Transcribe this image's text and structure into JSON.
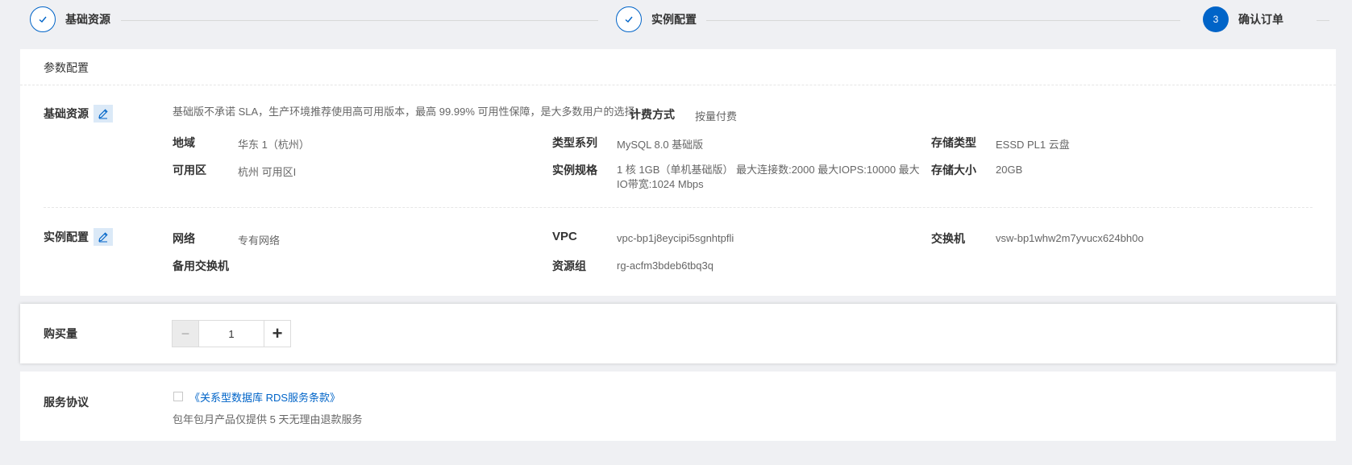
{
  "steps": [
    {
      "label": "基础资源",
      "status": "done",
      "icon": "check-icon"
    },
    {
      "label": "实例配置",
      "status": "done",
      "icon": "check-icon"
    },
    {
      "label": "确认订单",
      "status": "active",
      "number": "3"
    }
  ],
  "config_panel": {
    "title": "参数配置",
    "basic": {
      "label": "基础资源",
      "note": "基础版不承诺 SLA，生产环境推荐使用高可用版本，最高 99.99% 可用性保障，是大多数用户的选择!",
      "billing_key": "计费方式",
      "billing_value": "按量付费",
      "region_key": "地域",
      "region_value": "华东 1（杭州）",
      "series_key": "类型系列",
      "series_value": "MySQL 8.0 基础版",
      "storage_type_key": "存储类型",
      "storage_type_value": "ESSD PL1 云盘",
      "zone_key": "可用区",
      "zone_value": "杭州 可用区I",
      "spec_key": "实例规格",
      "spec_value": "1 核 1GB（单机基础版）   最大连接数:2000 最大IOPS:10000 最大IO带宽:1024 Mbps",
      "storage_size_key": "存储大小",
      "storage_size_value": "20GB"
    },
    "instance": {
      "label": "实例配置",
      "network_key": "网络",
      "network_value": "专有网络",
      "vpc_key": "VPC",
      "vpc_value": "vpc-bp1j8eycipi5sgnhtpfli",
      "vswitch_key": "交换机",
      "vswitch_value": "vsw-bp1whw2m7yvucx624bh0o",
      "backup_vswitch_key": "备用交换机",
      "resource_group_key": "资源组",
      "resource_group_value": "rg-acfm3bdeb6tbq3q"
    }
  },
  "quantity_panel": {
    "label": "购买量",
    "value": "1",
    "minus": "−",
    "plus": "+"
  },
  "agreement_panel": {
    "label": "服务协议",
    "link": "《关系型数据库 RDS服务条款》",
    "note": "包年包月产品仅提供 5 天无理由退款服务"
  },
  "colors": {
    "accent": "#0064c8",
    "background": "#eff0f3",
    "edit_bg": "#dbe9f7"
  }
}
